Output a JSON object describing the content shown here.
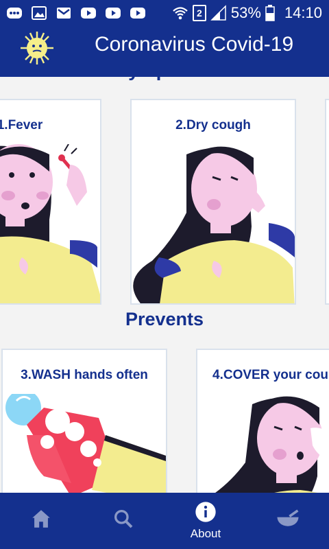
{
  "status_bar": {
    "battery": "53%",
    "time": "14:10",
    "sim": "2"
  },
  "app_bar": {
    "title": "Coronavirus Covid-19"
  },
  "symptoms": {
    "cards": [
      {
        "label": "1.Fever"
      },
      {
        "label": "2.Dry cough"
      }
    ]
  },
  "prevents": {
    "title": "Prevents",
    "cards": [
      {
        "label": "3.WASH hands often"
      },
      {
        "label": "4.COVER your cou"
      }
    ]
  },
  "bottom_nav": {
    "items": [
      {
        "icon": "home-icon",
        "label": ""
      },
      {
        "icon": "search-icon",
        "label": ""
      },
      {
        "icon": "info-icon",
        "label": "About"
      },
      {
        "icon": "mortar-icon",
        "label": ""
      }
    ]
  },
  "colors": {
    "primary": "#14308e",
    "skin": "#f6c9e6",
    "shirt": "#f3ec8f",
    "hair": "#1d1b2c",
    "accent": "#2e3aa6"
  }
}
